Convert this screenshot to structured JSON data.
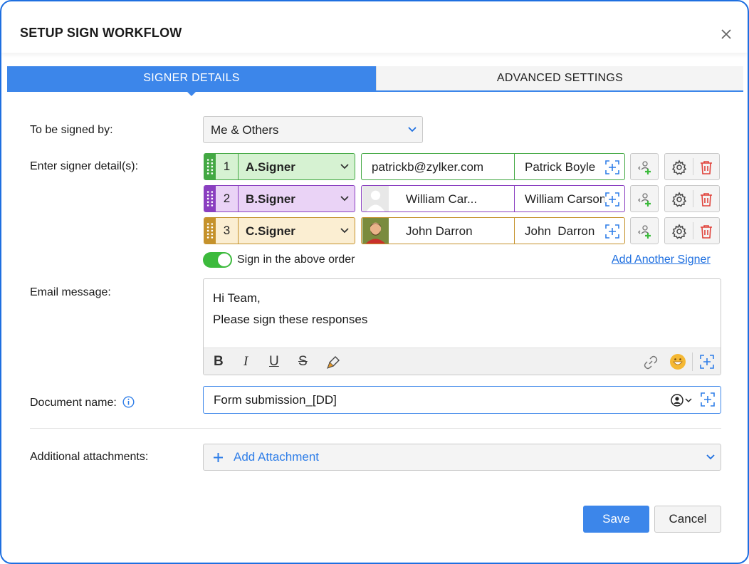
{
  "dialog": {
    "title": "SETUP SIGN WORKFLOW"
  },
  "tabs": [
    {
      "label": "SIGNER DETAILS",
      "active": true
    },
    {
      "label": "ADVANCED SETTINGS",
      "active": false
    }
  ],
  "form": {
    "signed_by_label": "To be signed by:",
    "signed_by_value": "Me & Others",
    "signer_details_label": "Enter signer detail(s):",
    "signers": [
      {
        "order": "1",
        "role": "A.Signer",
        "email": "patrickb@zylker.com",
        "name": "Patrick Boyle",
        "color": "#43a843",
        "bg": "#d6f2d2"
      },
      {
        "order": "2",
        "role": "B.Signer",
        "email": "William Car...",
        "name": "William Carson",
        "color": "#8a3fc0",
        "bg": "#ead3f6"
      },
      {
        "order": "3",
        "role": "C.Signer",
        "email": "John Darron",
        "name": "John  Darron",
        "color": "#c5922c",
        "bg": "#fbeed2"
      }
    ],
    "sign_order_label": "Sign in the above order",
    "sign_order_enabled": true,
    "add_signer_link": "Add Another Signer",
    "email_label": "Email message:",
    "email_lines": [
      "Hi Team,",
      "Please sign these responses"
    ],
    "doc_name_label": "Document name:",
    "doc_name_value": "Form submission_[DD]",
    "attachments_label": "Additional attachments:",
    "add_attachment": "Add Attachment"
  },
  "footer": {
    "save": "Save",
    "cancel": "Cancel"
  },
  "toolbar": {
    "bold": "B",
    "italic": "I",
    "underline": "U",
    "strike": "S"
  },
  "icons": [
    "close-icon",
    "chevron-down-icon",
    "drag-handle-icon",
    "insert-field-icon",
    "add-contact-icon",
    "gear-icon",
    "trash-icon",
    "link-icon",
    "emoji-icon",
    "info-icon",
    "person-icon",
    "plus-icon",
    "paint-icon"
  ]
}
